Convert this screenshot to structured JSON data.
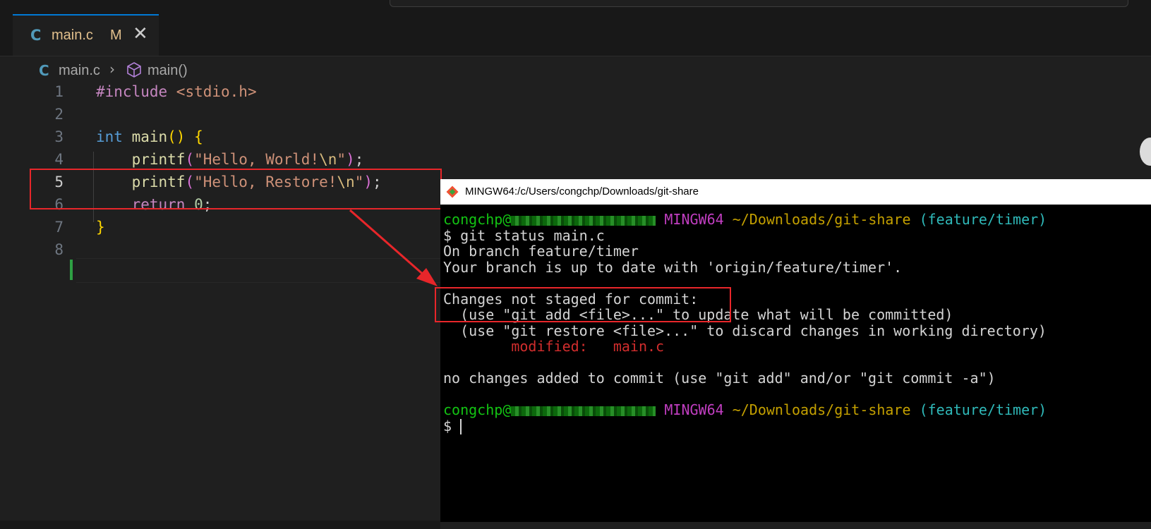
{
  "tab": {
    "icon": "C",
    "filename": "main.c",
    "status": "M",
    "close": "✕"
  },
  "breadcrumb": {
    "icon": "C",
    "file": "main.c",
    "separator": "›",
    "symbol": "main()"
  },
  "editor": {
    "line_numbers": [
      "1",
      "2",
      "3",
      "4",
      "5",
      "6",
      "7",
      "8"
    ],
    "active_line": "5",
    "lines": {
      "l1_pre": "#include",
      "l1_hdr": " <stdio.h>",
      "l3_type": "int",
      "l3_fn": " main",
      "l3_paren": "()",
      "l3_brace": " {",
      "l4_fn": "    printf",
      "l4_open": "(",
      "l4_str1": "\"Hello, World!",
      "l4_esc": "\\n",
      "l4_str2": "\"",
      "l4_close": ")",
      "l4_semi": ";",
      "l5_fn": "    printf",
      "l5_open": "(",
      "l5_str1": "\"Hello, Restore!",
      "l5_esc": "\\n",
      "l5_str2": "\"",
      "l5_close": ")",
      "l5_semi": ";",
      "l6_ret": "    return",
      "l6_num": " 0",
      "l6_semi": ";",
      "l7_brace": "}"
    }
  },
  "terminal": {
    "title": "MINGW64:/c/Users/congchp/Downloads/git-share",
    "prompt_user": "congchp@",
    "prompt_env": " MINGW64",
    "prompt_path": " ~/Downloads/git-share",
    "prompt_branch": " (feature/timer)",
    "cmd": "$ git status main.c",
    "out1": "On branch feature/timer",
    "out2": "Your branch is up to date with 'origin/feature/timer'.",
    "out3": "Changes not staged for commit:",
    "out4": "  (use \"git add <file>...\" to update what will be committed)",
    "out5": "  (use \"git restore <file>...\" to discard changes in working directory)",
    "mod_label": "        modified:",
    "mod_file": "   main.c",
    "out6": "no changes added to commit (use \"git add\" and/or \"git commit -a\")",
    "prompt2": "$ "
  },
  "colors": {
    "red_box": "#e8262a",
    "modified_bar": "#2ea043",
    "tab_accent": "#0078d4"
  },
  "icons": [
    "c-file-icon",
    "close-icon",
    "chevron-right-icon",
    "symbol-cube-icon",
    "git-bash-icon"
  ]
}
